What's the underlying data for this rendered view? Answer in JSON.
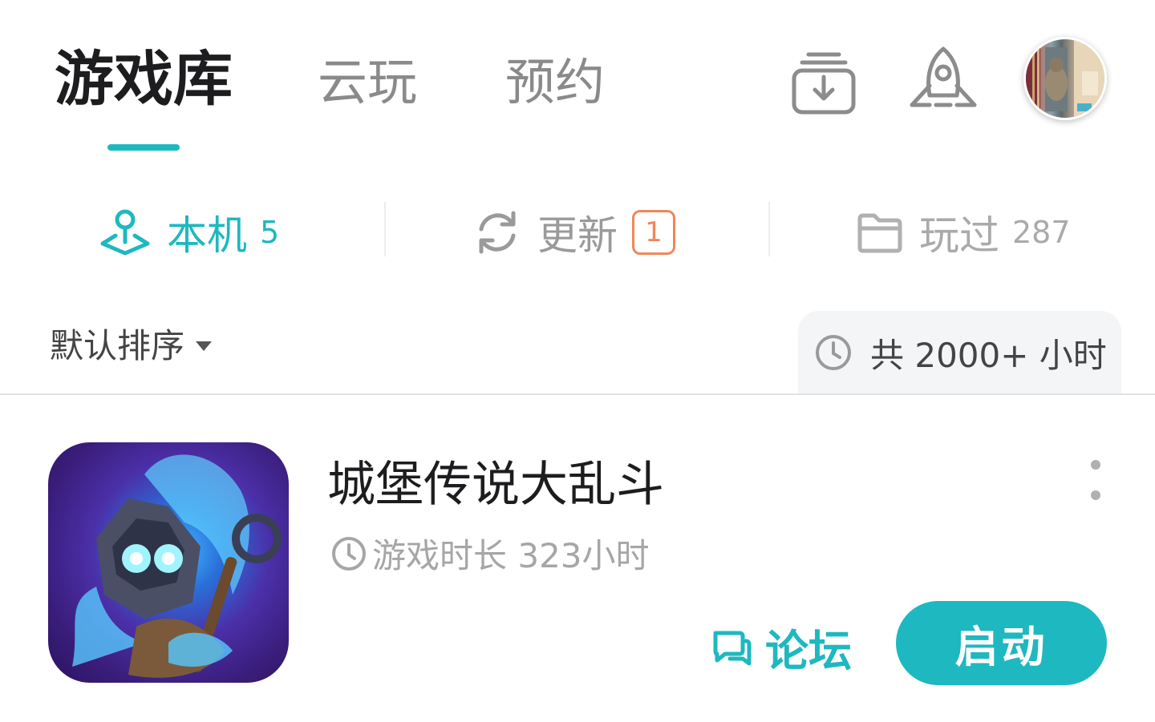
{
  "header": {
    "tabs": [
      {
        "label": "游戏库",
        "active": true
      },
      {
        "label": "云玩",
        "active": false
      },
      {
        "label": "预约",
        "active": false
      }
    ],
    "icons": [
      "download-manager-icon",
      "rocket-icon",
      "user-avatar"
    ]
  },
  "subtabs": [
    {
      "label": "本机",
      "count": "5",
      "icon": "joystick-icon",
      "active": true
    },
    {
      "label": "更新",
      "badge": "1",
      "icon": "refresh-icon",
      "active": false
    },
    {
      "label": "玩过",
      "count": "287",
      "icon": "folder-icon",
      "active": false
    }
  ],
  "sort": {
    "label": "默认排序"
  },
  "total_time": {
    "text": "共 2000+ 小时"
  },
  "games": [
    {
      "title": "城堡传说大乱斗",
      "playtime": "游戏时长 323小时",
      "forum_label": "论坛",
      "launch_label": "启动"
    }
  ],
  "colors": {
    "accent": "#1eb8c0",
    "badge": "#f0875a",
    "inactive": "#8a8a8a"
  }
}
